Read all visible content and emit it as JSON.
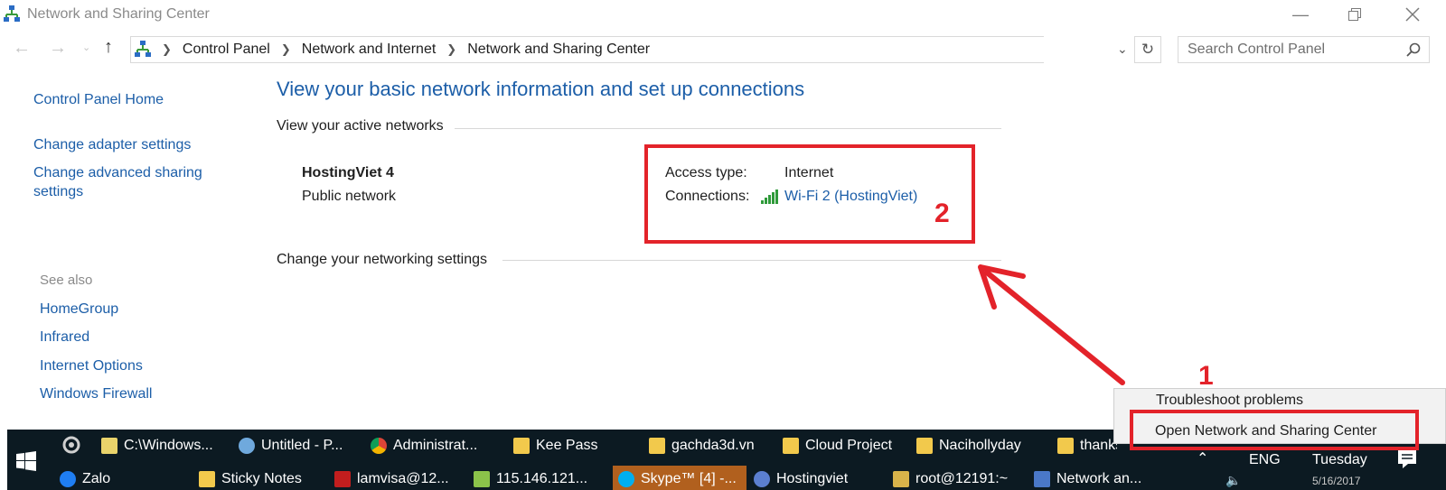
{
  "window": {
    "title": "Network and Sharing Center",
    "icon": "network-center-icon",
    "controls": [
      "minimize-icon",
      "restore-icon",
      "close-icon"
    ]
  },
  "address_bar": {
    "breadcrumbs": [
      "Control Panel",
      "Network and Internet",
      "Network and Sharing Center"
    ],
    "search_placeholder": "Search Control Panel"
  },
  "sidebar": {
    "home": "Control Panel Home",
    "links": [
      "Change adapter settings",
      "Change advanced sharing",
      "settings"
    ],
    "see_also_heading": "See also",
    "see_also": [
      "HomeGroup",
      "Infrared",
      "Internet Options",
      "Windows Firewall"
    ]
  },
  "main": {
    "title": "View your basic network information and set up connections",
    "active_networks_heading": "View your active networks",
    "network": {
      "name": "HostingViet 4",
      "type": "Public network",
      "access_type_label": "Access type:",
      "access_type_value": "Internet",
      "connections_label": "Connections:",
      "connections_value": "Wi-Fi 2 (HostingViet)"
    },
    "change_settings_heading": "Change your networking settings"
  },
  "annotations": {
    "step1": "1",
    "step2": "2",
    "color": "#e3232a"
  },
  "context_menu": {
    "items": [
      "Troubleshoot problems",
      "Open Network and Sharing Center"
    ]
  },
  "taskbar": {
    "row1": [
      {
        "label": "C:\\Windows...",
        "icon": "notepad-icon",
        "color": "#e9d36b"
      },
      {
        "label": "Untitled - P...",
        "icon": "paint-icon",
        "color": "#6fa9dd"
      },
      {
        "label": "Administrat...",
        "icon": "chrome-icon",
        "color": "#3aa757"
      },
      {
        "label": "Kee Pass",
        "icon": "folder-icon",
        "color": "#f2c94c"
      },
      {
        "label": "gachda3d.vn",
        "icon": "folder-icon",
        "color": "#f2c94c"
      },
      {
        "label": "Cloud Project",
        "icon": "folder-icon",
        "color": "#f2c94c"
      },
      {
        "label": "Naciholly­day",
        "icon": "folder-icon",
        "color": "#f2c94c"
      },
      {
        "label": "thanks",
        "icon": "folder-icon",
        "color": "#f2c94c"
      }
    ],
    "row2": [
      {
        "label": "Zalo",
        "icon": "zalo-icon",
        "color": "#1f7ef2"
      },
      {
        "label": "Sticky Notes",
        "icon": "folder-icon",
        "color": "#f2c94c"
      },
      {
        "label": "lamvisa@12...",
        "icon": "filezilla-icon",
        "color": "#c21e1e"
      },
      {
        "label": "115.146.121...",
        "icon": "remote-icon",
        "color": "#8bc34a"
      },
      {
        "label": "Skype™ [4] -...",
        "icon": "skype-icon",
        "color": "#00aff0"
      },
      {
        "label": "Hostingviet",
        "icon": "app-icon",
        "color": "#5b7fd0"
      },
      {
        "label": "root@12191:~",
        "icon": "terminal-icon",
        "color": "#d8b34a"
      },
      {
        "label": "Network an...",
        "icon": "network-center-icon",
        "color": "#4a78c8"
      }
    ],
    "tray": {
      "language": "ENG",
      "day": "Tuesday",
      "date": "5/16/2017"
    }
  }
}
